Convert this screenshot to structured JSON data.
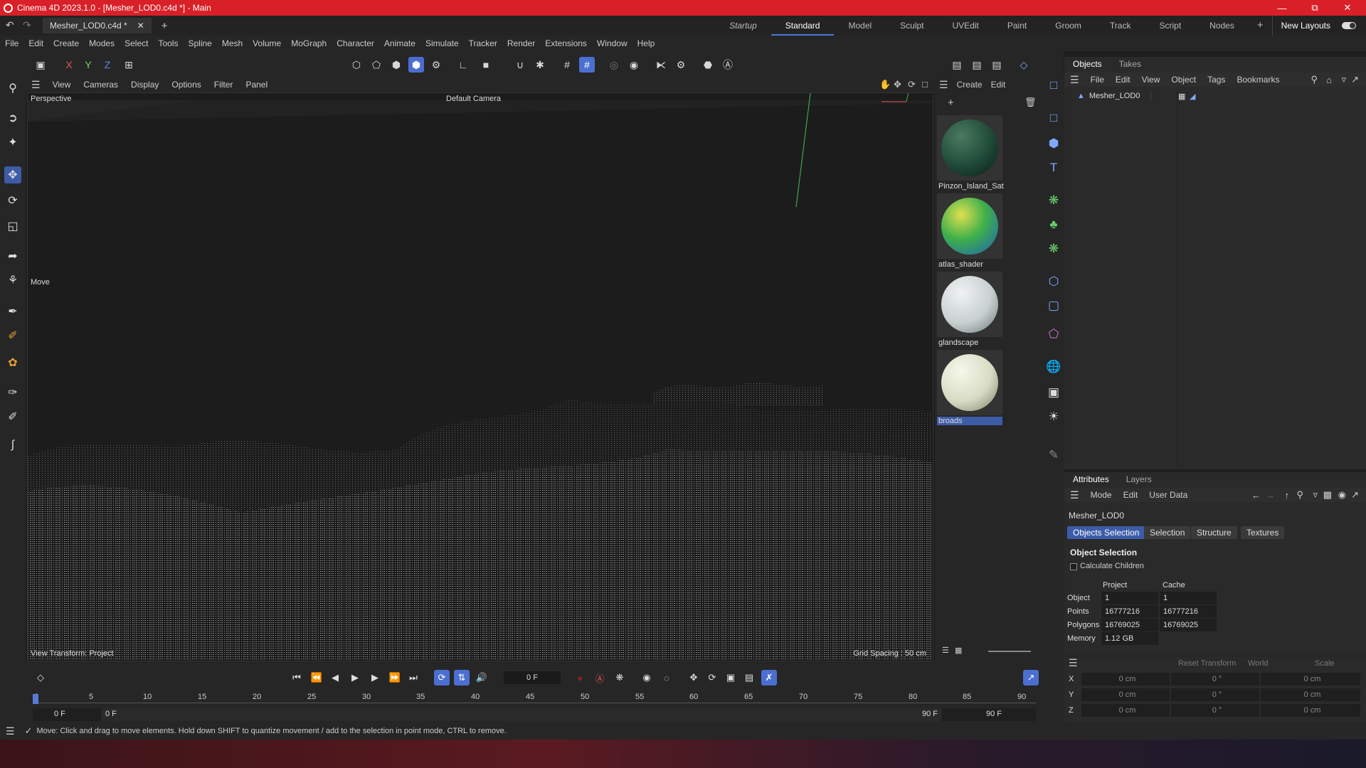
{
  "window": {
    "title": "Cinema 4D 2023.1.0 - [Mesher_LOD0.c4d *] - Main"
  },
  "doc_tab": {
    "label": "Mesher_LOD0.c4d *"
  },
  "layouts": [
    "Startup",
    "Standard",
    "Model",
    "Sculpt",
    "UVEdit",
    "Paint",
    "Groom",
    "Track",
    "Script",
    "Nodes"
  ],
  "layouts_active": "Standard",
  "new_layouts_label": "New Layouts",
  "menubar": [
    "File",
    "Edit",
    "Create",
    "Modes",
    "Select",
    "Tools",
    "Spline",
    "Mesh",
    "Volume",
    "MoGraph",
    "Character",
    "Animate",
    "Simulate",
    "Tracker",
    "Render",
    "Extensions",
    "Window",
    "Help"
  ],
  "axis_toggles": [
    "X",
    "Y",
    "Z"
  ],
  "viewport": {
    "menu": [
      "View",
      "Cameras",
      "Display",
      "Options",
      "Filter",
      "Panel"
    ],
    "label": "Perspective",
    "camera": "Default Camera",
    "tool": "Move",
    "view_transform": "View Transform: Project",
    "grid_spacing": "Grid Spacing : 50 cm"
  },
  "material_panel": {
    "menu": [
      "Create",
      "Edit"
    ],
    "materials": [
      {
        "name": "Pinzon_Island_Sat",
        "color": "#1f4a38"
      },
      {
        "name": "atlas_shader",
        "color": "#3fb04a"
      },
      {
        "name": "glandscape",
        "color": "#c8d0d0"
      },
      {
        "name": "broads",
        "color": "#d8dcc4"
      }
    ],
    "selected": "broads"
  },
  "objects_panel": {
    "tabs": [
      "Objects",
      "Takes"
    ],
    "menu": [
      "File",
      "Edit",
      "View",
      "Object",
      "Tags",
      "Bookmarks"
    ],
    "items": [
      {
        "name": "Mesher_LOD0"
      }
    ]
  },
  "attributes_panel": {
    "tabs": [
      "Attributes",
      "Layers"
    ],
    "menu": [
      "Mode",
      "Edit",
      "User Data"
    ],
    "object_name": "Mesher_LOD0",
    "subtabs": [
      "Objects Selection",
      "Selection",
      "Structure",
      "Textures"
    ],
    "section_title": "Object Selection",
    "calculate_children": "Calculate Children",
    "columns": [
      "Project",
      "Cache"
    ],
    "rows": [
      {
        "label": "Object",
        "project": "1",
        "cache": "1"
      },
      {
        "label": "Points",
        "project": "16777216",
        "cache": "16777216"
      },
      {
        "label": "Polygons",
        "project": "16769025",
        "cache": "16769025"
      },
      {
        "label": "Memory",
        "project": "1.12 GB",
        "cache": ""
      }
    ]
  },
  "coords_panel": {
    "reset_transform": "Reset Transform",
    "space": "World",
    "mode": "Scale",
    "rows": [
      {
        "axis": "X",
        "pos": "0 cm",
        "rot": "0 °",
        "scale": "0 cm"
      },
      {
        "axis": "Y",
        "pos": "0 cm",
        "rot": "0 °",
        "scale": "0 cm"
      },
      {
        "axis": "Z",
        "pos": "0 cm",
        "rot": "0 °",
        "scale": "0 cm"
      }
    ]
  },
  "timeline": {
    "current_frame": "0 F",
    "ticks": [
      "0",
      "5",
      "10",
      "15",
      "20",
      "25",
      "30",
      "35",
      "40",
      "45",
      "50",
      "55",
      "60",
      "65",
      "70",
      "75",
      "80",
      "85",
      "90"
    ],
    "start": "0 F",
    "min": "0 F",
    "max": "90 F",
    "end": "90 F"
  },
  "status": {
    "text": "Move: Click and drag to move elements. Hold down SHIFT to quantize movement / add to the selection in point mode, CTRL to remove."
  }
}
